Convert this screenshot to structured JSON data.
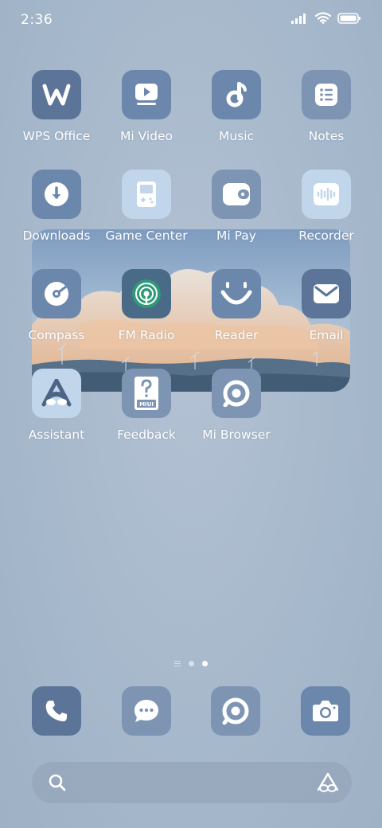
{
  "status_bar": {
    "time": "2:36",
    "icons": [
      "signal-icon",
      "wifi-icon",
      "battery-icon"
    ]
  },
  "apps": [
    {
      "label": "WPS Office",
      "icon": "wps-office-icon"
    },
    {
      "label": "Mi Video",
      "icon": "mi-video-icon"
    },
    {
      "label": "Music",
      "icon": "music-icon"
    },
    {
      "label": "Notes",
      "icon": "notes-icon"
    },
    {
      "label": "Downloads",
      "icon": "downloads-icon"
    },
    {
      "label": "Game Center",
      "icon": "game-center-icon"
    },
    {
      "label": "Mi Pay",
      "icon": "mi-pay-icon"
    },
    {
      "label": "Recorder",
      "icon": "recorder-icon"
    },
    {
      "label": "Compass",
      "icon": "compass-icon"
    },
    {
      "label": "FM Radio",
      "icon": "fm-radio-icon"
    },
    {
      "label": "Reader",
      "icon": "reader-icon"
    },
    {
      "label": "Email",
      "icon": "email-icon"
    },
    {
      "label": "Assistant",
      "icon": "assistant-icon"
    },
    {
      "label": "Feedback",
      "icon": "feedback-icon"
    },
    {
      "label": "Mi Browser",
      "icon": "mi-browser-icon"
    }
  ],
  "feedback_icon_text": "MIUI",
  "widget": {
    "icon": "landscape-photo-widget"
  },
  "page_indicator": {
    "pages": 3,
    "current": 3
  },
  "dock": [
    {
      "icon": "phone-icon"
    },
    {
      "icon": "messaging-icon"
    },
    {
      "icon": "browser-icon"
    },
    {
      "icon": "camera-icon"
    }
  ],
  "search": {
    "icons": [
      "search-icon",
      "assistant-icon"
    ]
  },
  "colors": {
    "wallpaper": "#a9bacd",
    "icon_dark": "#5c7498",
    "icon_mid": "#6c87ac",
    "icon_light": "#c2d6eb"
  }
}
